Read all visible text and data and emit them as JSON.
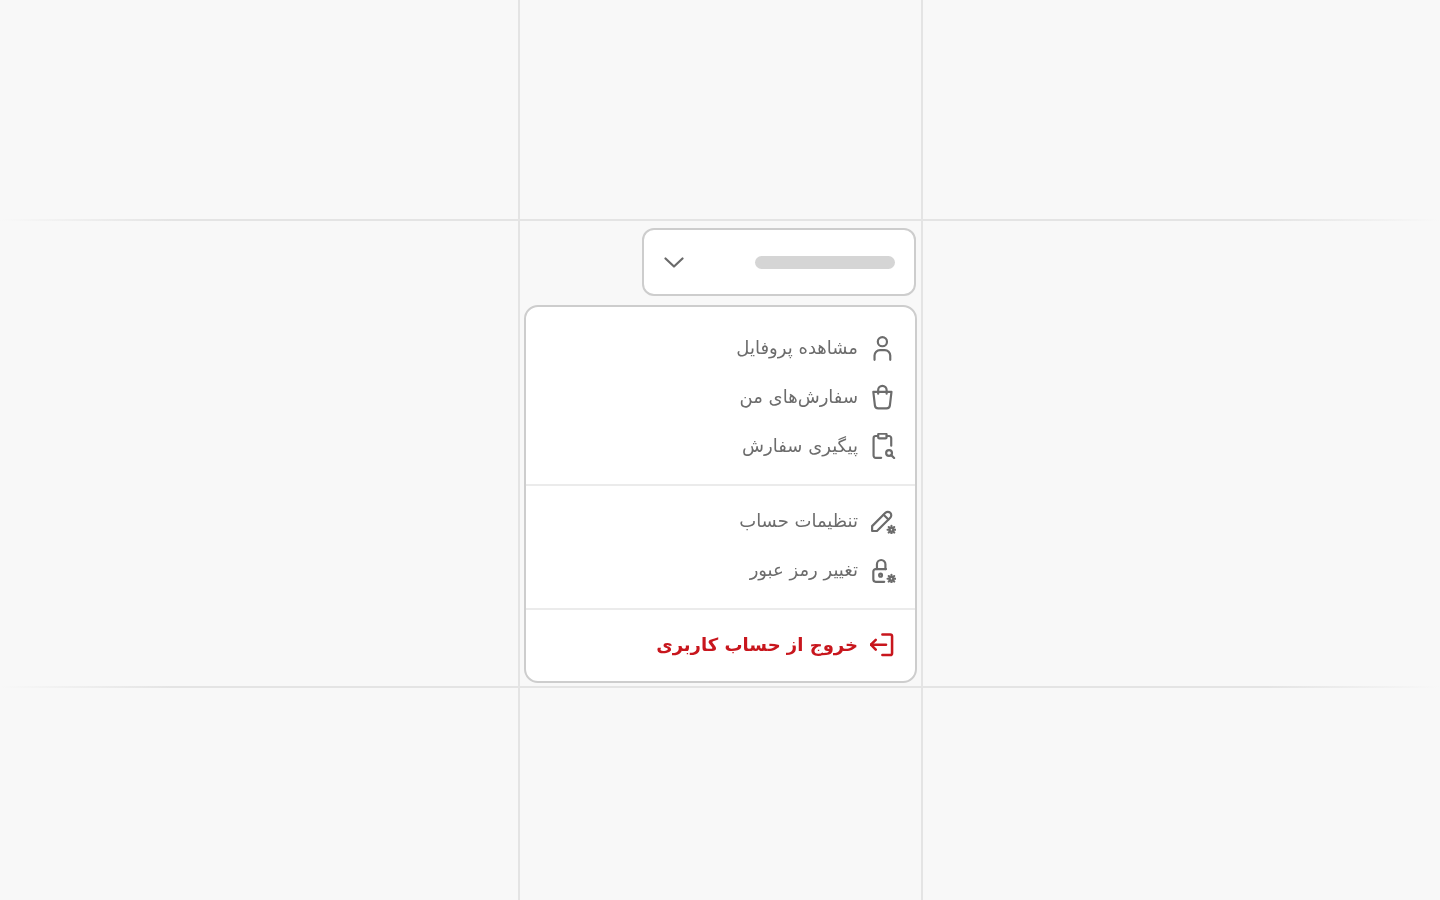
{
  "trigger": {
    "loading": true
  },
  "menu": {
    "expanded": true,
    "groups": [
      {
        "items": [
          {
            "label": "مشاهده پروفایل",
            "kind": "default"
          },
          {
            "label": "سفارش‌های من",
            "kind": "default"
          },
          {
            "label": "پیگیری سفارش",
            "kind": "default"
          }
        ]
      },
      {
        "items": [
          {
            "label": "تنظیمات حساب",
            "kind": "default"
          },
          {
            "label": "تغییر رمز عبور",
            "kind": "default"
          }
        ]
      },
      {
        "items": [
          {
            "label": "خروج از حساب کاربری",
            "kind": "danger"
          }
        ]
      }
    ]
  }
}
